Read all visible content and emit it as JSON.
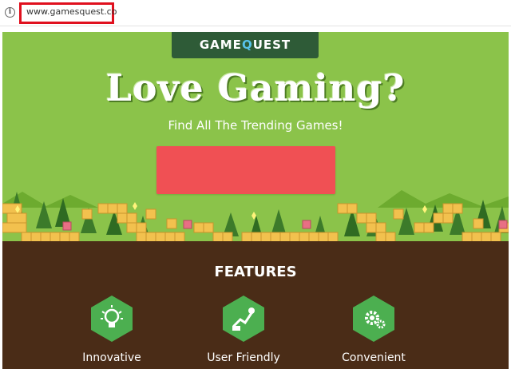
{
  "browser": {
    "url": "www.gamesquest.co",
    "info_icon": "info-icon",
    "highlight_color": "#e0101e"
  },
  "header": {
    "logo_prefix": "GAME",
    "logo_q": "Q",
    "logo_suffix": "UEST"
  },
  "hero": {
    "title": "Love Gaming?",
    "subtitle": "Find All The Trending Games!",
    "cta_color": "#f05054"
  },
  "features": {
    "heading": "FEATURES",
    "items": [
      {
        "label": "Innovative",
        "icon": "lightbulb-icon"
      },
      {
        "label": "User Friendly",
        "icon": "user-friendly-icon"
      },
      {
        "label": "Convenient",
        "icon": "gear-icon"
      }
    ]
  },
  "colors": {
    "grass": "#8bc34a",
    "dirt": "#4a2c17",
    "banner": "#2e5b37",
    "hexagon": "#4caf50",
    "brick": "#f2c14e"
  }
}
